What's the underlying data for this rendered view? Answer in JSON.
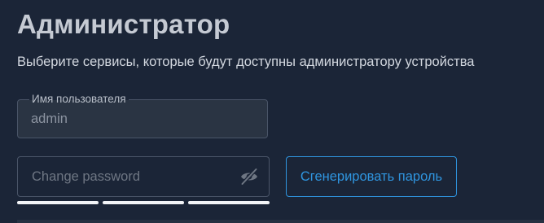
{
  "header": {
    "title": "Администратор",
    "subtitle": "Выберите сервисы, которые будут доступны администратору устройства"
  },
  "form": {
    "username": {
      "label": "Имя пользователя",
      "value": "admin"
    },
    "password": {
      "placeholder": "Change password",
      "toggle_icon": "eye-off-icon",
      "strength_segments": 3
    },
    "generate_label": "Сгенерировать пароль"
  },
  "colors": {
    "background": "#1b2537",
    "accent": "#2f95df",
    "strength_bar": "#f2f4f7"
  }
}
